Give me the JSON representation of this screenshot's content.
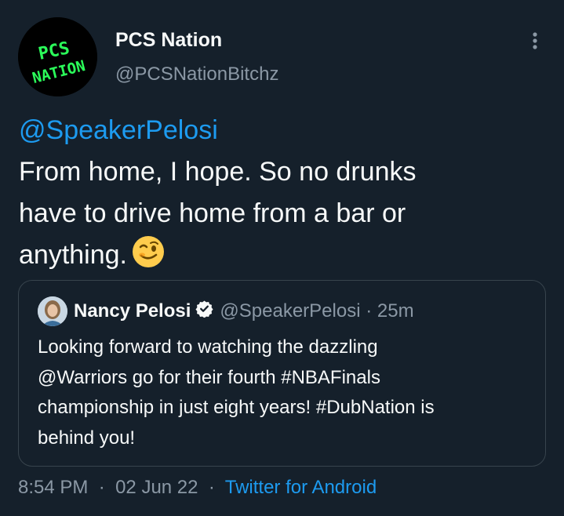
{
  "author": {
    "display_name": "PCS Nation",
    "handle": "@PCSNationBitchz",
    "avatar_text_line1": "PCS",
    "avatar_text_line2": "NATION"
  },
  "tweet": {
    "mention": "@SpeakerPelosi",
    "lines": [
      "From home, I hope. So no drunks",
      "have to drive home from a bar or",
      "anything."
    ],
    "emoji": "winking-face"
  },
  "quoted_tweet": {
    "display_name": "Nancy Pelosi",
    "handle": "@SpeakerPelosi",
    "separator": "·",
    "time_ago": "25m",
    "lines": [
      "Looking forward to watching the dazzling",
      "@Warriors go for their fourth #NBAFinals",
      "championship in just eight years! #DubNation is",
      "behind you!"
    ]
  },
  "footer": {
    "time": "8:54 PM",
    "separator": "·",
    "date": "02 Jun 22",
    "separator2": "·",
    "source": "Twitter for Android"
  },
  "colors": {
    "background": "#15202b",
    "text": "#f7f9f9",
    "secondary": "#8b98a5",
    "accent": "#1d9bf0",
    "border": "#38444d",
    "avatar_lettering": "#2bff5a"
  },
  "icons": {
    "more": "more-vertical-icon",
    "verified": "verified-badge-icon"
  }
}
